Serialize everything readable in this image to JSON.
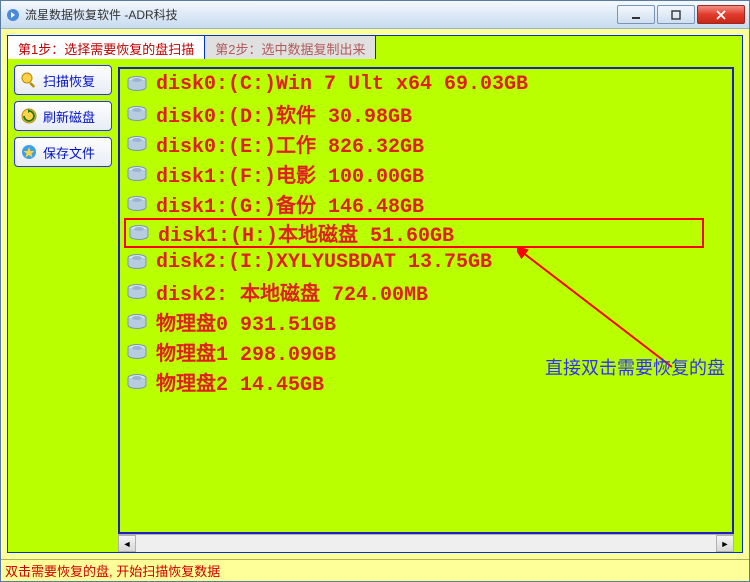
{
  "window": {
    "title": "流星数据恢复软件  -ADR科技"
  },
  "tabs": [
    {
      "label": "第1步：选择需要恢复的盘扫描",
      "active": true
    },
    {
      "label": "第2步：选中数据复制出来",
      "active": false
    }
  ],
  "sidebar": {
    "scan_recover": "扫描恢复",
    "refresh_disk": "刷新磁盘",
    "save_files": "保存文件"
  },
  "disks": [
    {
      "label": "disk0:(C:)Win 7 Ult x64 69.03GB",
      "highlighted": false
    },
    {
      "label": "disk0:(D:)软件 30.98GB",
      "highlighted": false
    },
    {
      "label": "disk0:(E:)工作 826.32GB",
      "highlighted": false
    },
    {
      "label": "disk1:(F:)电影 100.00GB",
      "highlighted": false
    },
    {
      "label": "disk1:(G:)备份 146.48GB",
      "highlighted": false
    },
    {
      "label": "disk1:(H:)本地磁盘 51.60GB",
      "highlighted": true
    },
    {
      "label": "disk2:(I:)XYLYUSBDAT 13.75GB",
      "highlighted": false
    },
    {
      "label": "disk2:   本地磁盘 724.00MB",
      "highlighted": false
    },
    {
      "label": "物理盘0 931.51GB",
      "highlighted": false
    },
    {
      "label": "物理盘1 298.09GB",
      "highlighted": false
    },
    {
      "label": "物理盘2 14.45GB",
      "highlighted": false
    }
  ],
  "annotation": {
    "text": "直接双击需要恢复的盘"
  },
  "statusbar": {
    "text": "双击需要恢复的盘, 开始扫描恢复数据"
  },
  "icons": {
    "app": "app-icon",
    "minimize": "minimize-icon",
    "maximize": "maximize-icon",
    "close": "close-icon",
    "hdd": "hdd-icon",
    "scan": "magnifier-icon",
    "refresh": "refresh-icon",
    "save": "star-icon",
    "arrow_left": "arrow-left-icon",
    "arrow_right": "arrow-right-icon"
  }
}
